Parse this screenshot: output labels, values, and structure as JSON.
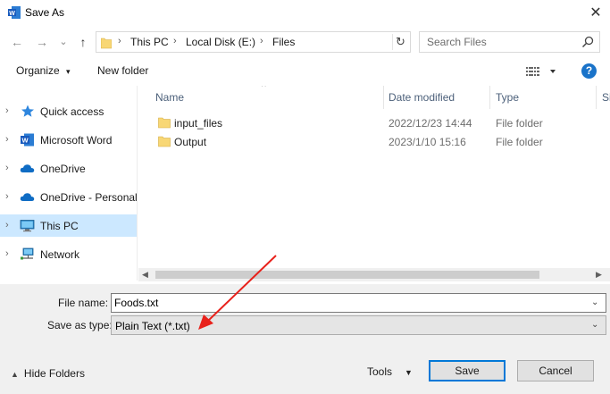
{
  "window": {
    "title": "Save As",
    "close_glyph": "✕"
  },
  "nav": {
    "back_glyph": "←",
    "forward_glyph": "→",
    "recent_glyph": "⌄",
    "up_glyph": "↑",
    "breadcrumb": [
      "This PC",
      "Local Disk (E:)",
      "Files"
    ],
    "separator": "›",
    "refresh_glyph": "↻",
    "search_placeholder": "Search Files"
  },
  "toolbar": {
    "organize_label": "Organize",
    "organize_caret": "▾",
    "new_folder_label": "New folder",
    "help_label": "?"
  },
  "sidebar": {
    "items": [
      {
        "label": "Quick access",
        "icon": "star-icon",
        "selected": false
      },
      {
        "label": "Microsoft Word",
        "icon": "word-icon",
        "selected": false
      },
      {
        "label": "OneDrive",
        "icon": "cloud-icon",
        "selected": false
      },
      {
        "label": "OneDrive - Personal",
        "icon": "cloud-icon",
        "selected": false
      },
      {
        "label": "This PC",
        "icon": "computer-icon",
        "selected": true
      },
      {
        "label": "Network",
        "icon": "network-icon",
        "selected": false
      }
    ],
    "chevron": "›"
  },
  "files": {
    "columns": [
      "Name",
      "Date modified",
      "Type",
      "Si"
    ],
    "sort_glyph": "^",
    "rows": [
      {
        "name": "input_files",
        "date": "2022/12/23 14:44",
        "type": "File folder"
      },
      {
        "name": "Output",
        "date": "2023/1/10 15:16",
        "type": "File folder"
      }
    ]
  },
  "scrollbar": {
    "left_glyph": "◀",
    "right_glyph": "▶"
  },
  "save_form": {
    "file_name_label": "File name:",
    "file_name_value": "Foods.txt",
    "save_type_label": "Save as type:",
    "save_type_value": "Plain Text (*.txt)",
    "dropdown_glyph": "⌄"
  },
  "footer": {
    "hide_folders_label": "Hide Folders",
    "hide_caret": "▲",
    "tools_label": "Tools",
    "tools_caret": "▼",
    "save_label": "Save",
    "cancel_label": "Cancel"
  },
  "colors": {
    "accent": "#0078d7",
    "selection": "#cce8ff",
    "folder": "#f8d775",
    "annotation_arrow": "#e8211b"
  }
}
